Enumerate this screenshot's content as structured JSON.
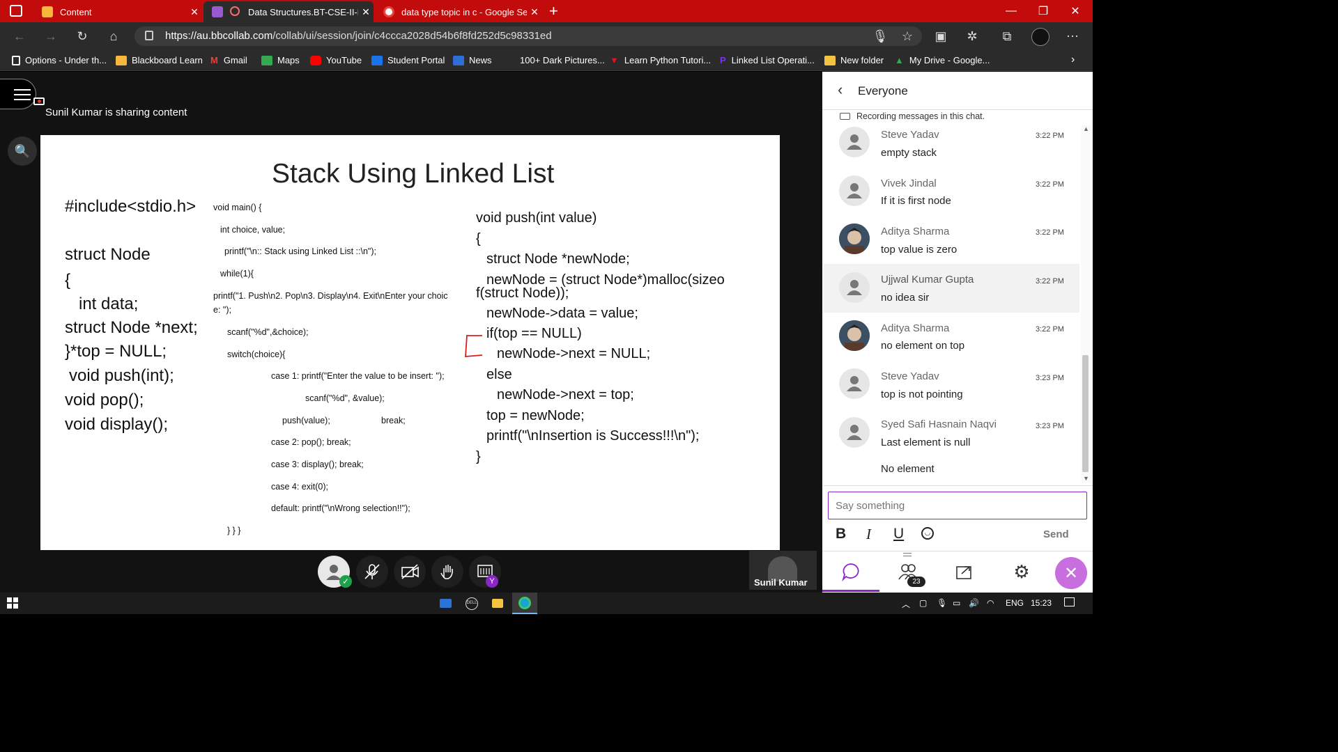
{
  "browser": {
    "tabs": [
      {
        "title": "Content",
        "color": "#f6b73c"
      },
      {
        "title": "Data Structures.BT-CSE-II-B",
        "color": "#9b59d0"
      },
      {
        "title": "data type topic in c - Google Sea",
        "color": "#ea4335"
      }
    ],
    "url_host": "https://au.bbcollab.com",
    "url_path": "/collab/ui/session/join/c4ccca2028d54b6f8fd252d5c98331ed",
    "bookmarks": [
      {
        "label": "Options - Under th...",
        "color": "#ffffff"
      },
      {
        "label": "Blackboard Learn",
        "color": "#f6b73c"
      },
      {
        "label": "Gmail",
        "color": "#ea4335"
      },
      {
        "label": "Maps",
        "color": "#34a853"
      },
      {
        "label": "YouTube",
        "color": "#ff0000"
      },
      {
        "label": "Student Portal",
        "color": "#1a73e8"
      },
      {
        "label": "News",
        "color": "#2f6ed8"
      },
      {
        "label": "100+ Dark Pictures...",
        "color": "#2b2b2b"
      },
      {
        "label": "Learn Python Tutori...",
        "color": "#e0161b"
      },
      {
        "label": "Linked List Operati...",
        "color": "#7b2ff7"
      },
      {
        "label": "New folder",
        "color": "#f4c542"
      },
      {
        "label": "My Drive - Google...",
        "color": "#34a853"
      }
    ]
  },
  "session": {
    "sharing_text": "Sunil Kumar is sharing content",
    "presenter_name": "Sunil Kumar"
  },
  "slide": {
    "title": "Stack Using Linked List",
    "left_code": [
      "#include<stdio.h>",
      "struct Node",
      "{",
      "int data;",
      "struct Node *next;",
      "}*top = NULL;",
      "void push(int);",
      "void pop();",
      "void display();"
    ],
    "main_code": [
      "void main() {",
      "int choice, value;",
      "printf(\"\\n:: Stack using Linked List ::\\n\");",
      "while(1){",
      "printf(\"1. Push\\n2. Pop\\n3. Display\\n4. Exit\\nEnter your choic",
      "e: \");",
      "scanf(\"%d\",&choice);",
      "switch(choice){",
      "case 1: printf(\"Enter the value to be insert: \");",
      "scanf(\"%d\", &value);",
      "push(value);",
      "break;",
      "case 2: pop(); break;",
      "case 3: display(); break;",
      "case 4: exit(0);",
      "default: printf(\"\\nWrong selection!!\");",
      "}  }  }"
    ],
    "push_code": [
      "void push(int value)",
      "{",
      "struct Node *newNode;",
      "newNode = (struct Node*)malloc(sizeo",
      "f(struct Node));",
      "newNode->data = value;",
      "if(top == NULL)",
      "newNode->next = NULL;",
      "else",
      "newNode->next = top;",
      "top = newNode;",
      "printf(\"\\nInsertion is Success!!!\\n\");",
      "}"
    ]
  },
  "chat": {
    "header": "Everyone",
    "recording_notice": "Recording messages in this chat.",
    "messages": [
      {
        "name": "Steve Yadav",
        "text": "empty stack",
        "time": "3:22 PM"
      },
      {
        "name": "Vivek Jindal",
        "text": "If it is first node",
        "time": "3:22 PM"
      },
      {
        "name": "Aditya Sharma",
        "text": "top value is zero",
        "time": "3:22 PM"
      },
      {
        "name": "Ujjwal Kumar Gupta",
        "text": "no idea sir",
        "time": "3:22 PM"
      },
      {
        "name": "Aditya Sharma",
        "text": "no element on top",
        "time": "3:22 PM"
      },
      {
        "name": "Steve Yadav",
        "text": "top is not pointing",
        "time": "3:23 PM"
      },
      {
        "name": "Syed Safi Hasnain Naqvi",
        "text": "Last element is null",
        "time": "3:23 PM"
      }
    ],
    "followup_text": "No element",
    "input_placeholder": "Say something",
    "format_bold": "B",
    "format_italic": "I",
    "format_underline": "U",
    "send_label": "Send",
    "attendee_count": "23",
    "accent_color": "#8b26c5"
  },
  "taskbar": {
    "lang": "ENG",
    "time": "15:23"
  }
}
